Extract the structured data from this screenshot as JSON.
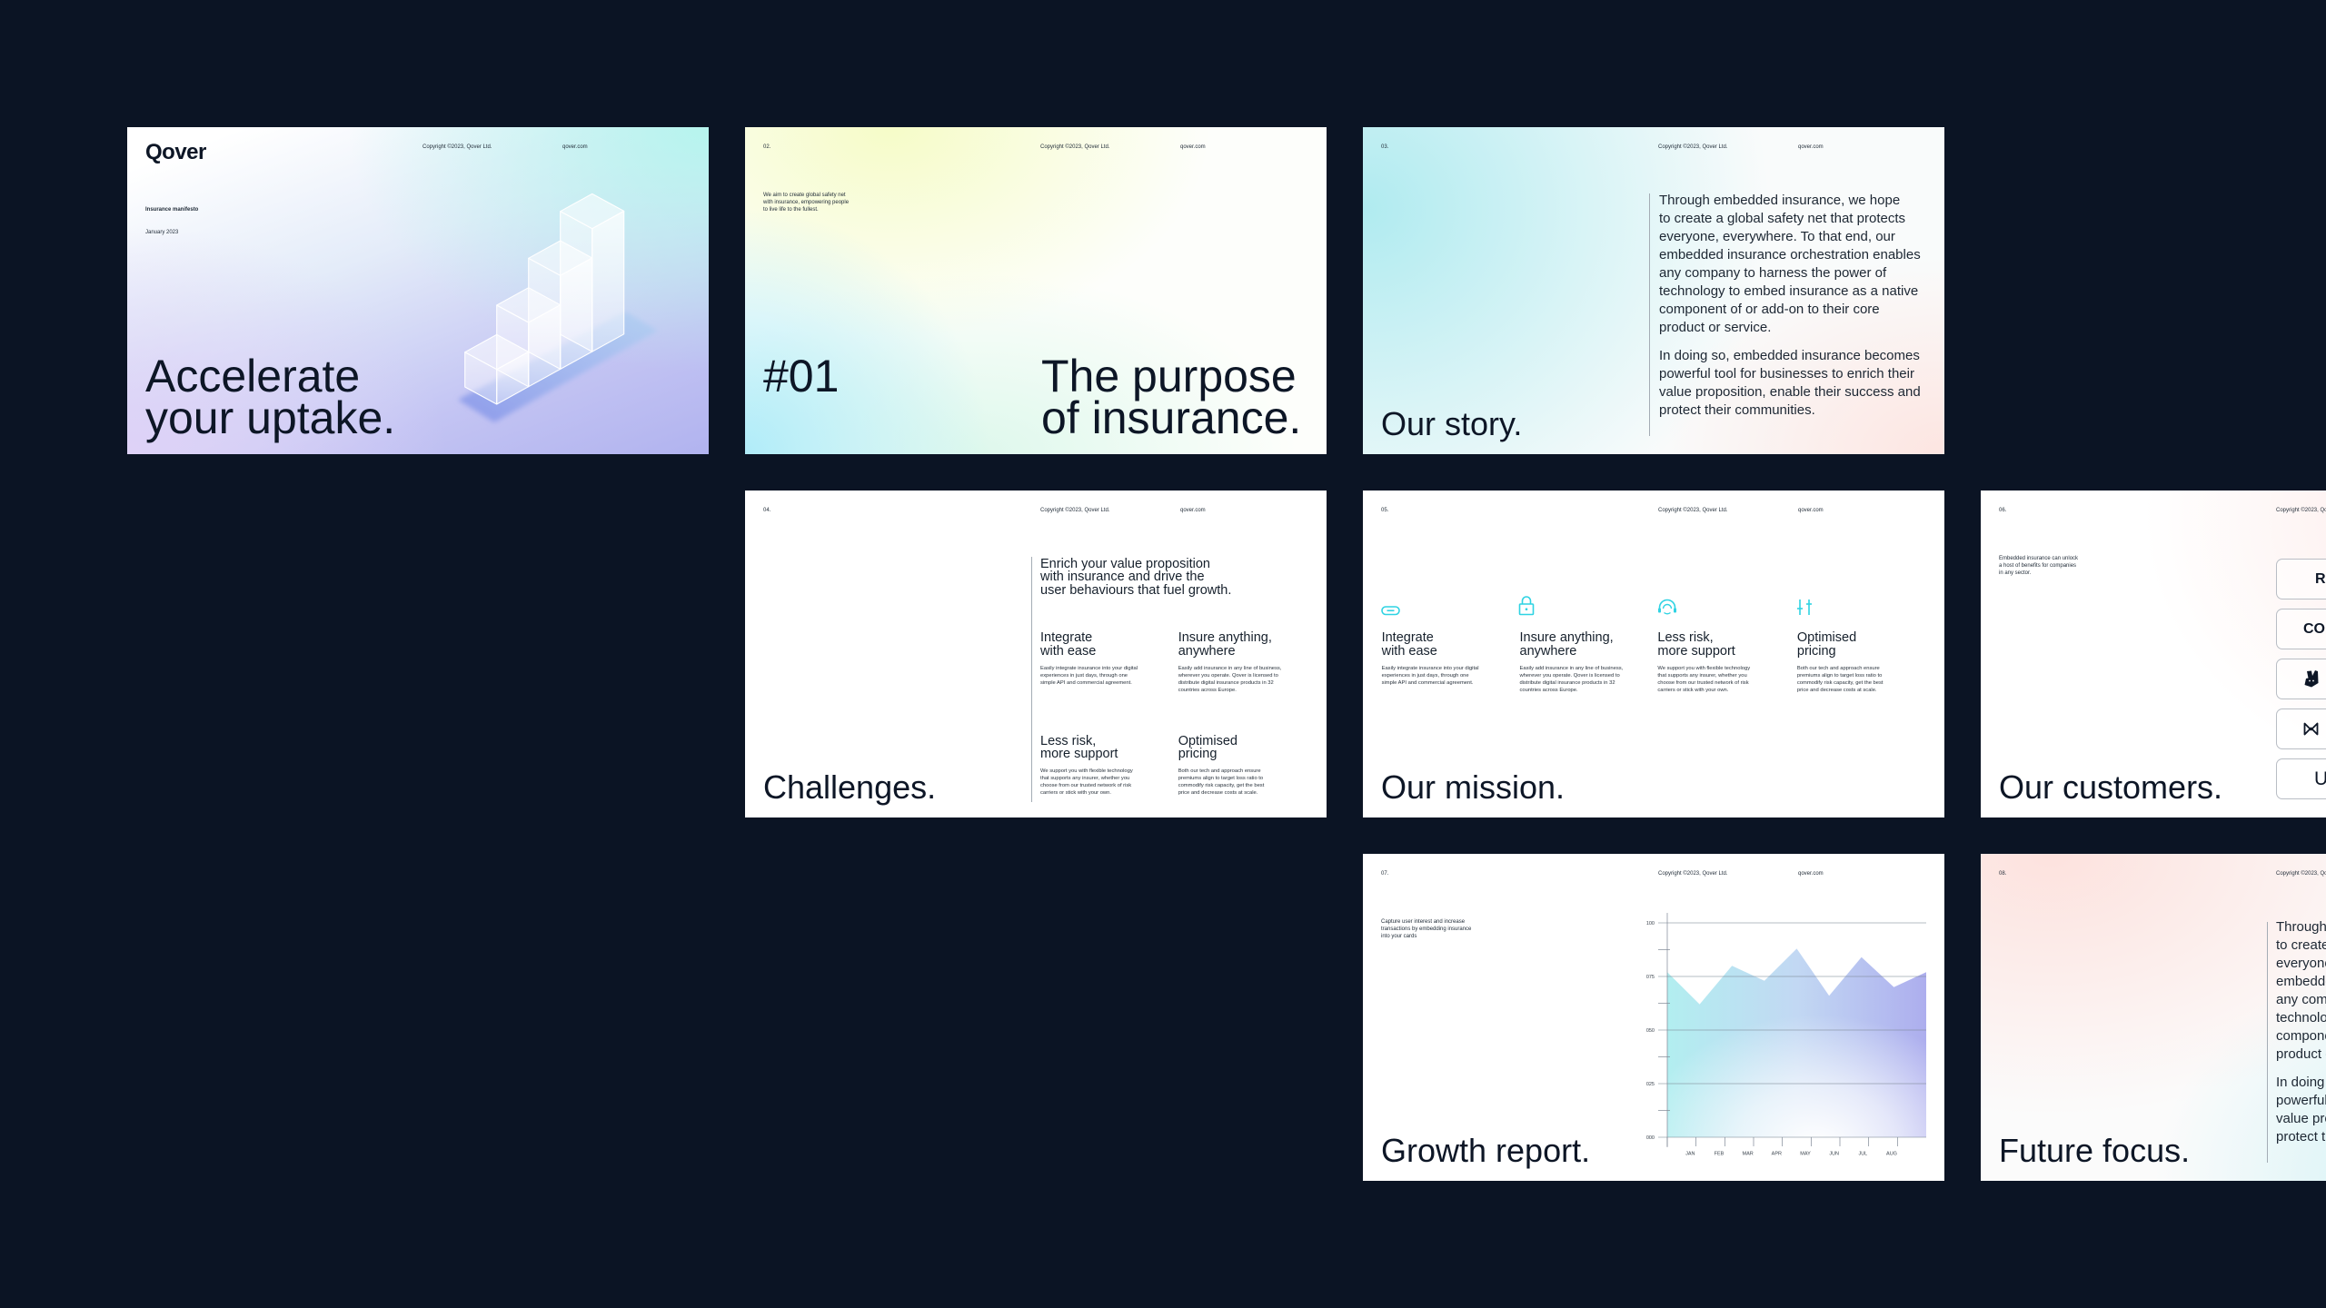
{
  "canvas": {
    "background": "#0b1424"
  },
  "colors": {
    "ink": "#0d1626",
    "accent": "#2fd3e3",
    "divider": "#a4acb5"
  },
  "common": {
    "copyright": "Copyright ©2023, Qover Ltd.",
    "website": "qover.com"
  },
  "features": [
    {
      "icon": "link-icon",
      "title": "Integrate\nwith ease",
      "body": "Easily integrate insurance into your digital\nexperiences in just days, through one\nsimple API and commercial agreement."
    },
    {
      "icon": "lock-icon",
      "title": "Insure anything,\nanywhere",
      "body": "Easily add insurance in any line of business,\nwherever you operate. Qover is licensed to\ndistribute digital insurance products in 32\ncountries across Europe."
    },
    {
      "icon": "headset-icon",
      "title": "Less risk,\nmore support",
      "body": "We support you with flexible technology\nthat supports any insurer, whether you\nchoose from our trusted network of risk\ncarriers or stick with your own."
    },
    {
      "icon": "sliders-icon",
      "title": "Optimised\npricing",
      "body": "Both our tech and approach ensure\npremiums align to target loss ratio to\ncommodify risk capacity, get the best\nprice and decrease costs at scale."
    }
  ],
  "slides": {
    "cover": {
      "logo": "Qover",
      "doc_title": "Insurance manifesto",
      "date": "January 2023",
      "headline": "Accelerate\nyour uptake.",
      "illustration": "isometric-growth-bars"
    },
    "purpose": {
      "page": "02.",
      "intro": "We aim to create global safety net\nwith insurance, empowering people\nto live life to the fullest.",
      "number": "#01",
      "headline": "The purpose\nof insurance."
    },
    "story": {
      "page": "03.",
      "paragraphs": [
        "Through embedded insurance, we hope\nto create a global safety net that protects\neveryone, everywhere. To that end, our\nembedded insurance orchestration enables\nany company to harness the power of\ntechnology to embed insurance as a native\ncomponent of or add-on to their core\nproduct or service.",
        "In doing so, embedded insurance becomes\npowerful tool for businesses to enrich their\nvalue proposition, enable their success and\nprotect their communities."
      ],
      "headline": "Our story."
    },
    "challenges": {
      "page": "04.",
      "intro": "Enrich your value proposition\nwith insurance and drive the\nuser behaviours that fuel growth.",
      "headline": "Challenges."
    },
    "mission": {
      "page": "05.",
      "headline": "Our mission."
    },
    "customers": {
      "page": "06.",
      "intro": "Embedded insurance can unlock\na host of benefits for companies\nin any sector.",
      "logos": [
        {
          "type": "text",
          "label": "Re"
        },
        {
          "type": "text",
          "label": "CO"
        },
        {
          "type": "icon",
          "icon": "kangaroo-logo"
        },
        {
          "type": "icon",
          "icon": "m-mark-logo"
        },
        {
          "type": "text",
          "label": "U"
        }
      ],
      "headline": "Our customers."
    },
    "growth": {
      "page": "07.",
      "intro": "Capture user interest and increase\ntransactions by embedding insurance\ninto your cards",
      "headline": "Growth report."
    },
    "future": {
      "page": "08.",
      "paragraphs": [
        "Through embedded insurance, we hope\nto create a global safety net that protects\neveryone, everywhere. To that end, our\nembedded insurance orchestration enables\nany company to harness the power of\ntechnology to embed insurance as a native\ncomponent of or add-on to their core\nproduct or service.",
        "In doing so, embedded insurance becomes\npowerful tool for businesses to enrich their\nvalue proposition, enable their success and\nprotect their communities."
      ],
      "headline": "Future focus."
    }
  },
  "chart_data": {
    "type": "area",
    "title": "",
    "xlabel": "",
    "ylabel": "",
    "x": [
      0,
      1,
      2,
      3,
      4,
      5,
      6,
      7,
      8
    ],
    "series": [
      {
        "name": "growth",
        "values": [
          77,
          62,
          80,
          73,
          88,
          66,
          84,
          70,
          77
        ]
      }
    ],
    "categories": [
      "JAN",
      "FEB",
      "MAR",
      "APR",
      "MAY",
      "JUN",
      "JUL",
      "AUG"
    ],
    "ylim": [
      0,
      100
    ],
    "yticks": [
      0,
      25,
      50,
      75,
      100
    ],
    "ytick_labels": [
      "000",
      "025",
      "050",
      "075",
      "100"
    ],
    "minor_yticks": [
      12.5,
      37.5,
      62.5,
      87.5
    ],
    "grid": true,
    "legend": "none"
  }
}
